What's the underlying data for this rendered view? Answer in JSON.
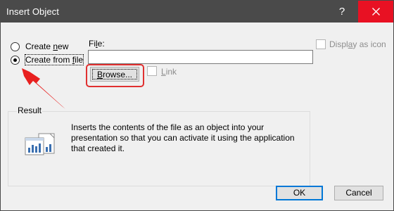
{
  "window": {
    "title": "Insert Object",
    "help_glyph": "?",
    "close_icon": "close-icon"
  },
  "options": {
    "create_new": {
      "prefix": "Create ",
      "accel": "n",
      "suffix": "ew",
      "selected": false
    },
    "create_from_file": {
      "prefix": "Create from ",
      "accel": "f",
      "suffix": "ile",
      "selected": true
    }
  },
  "file": {
    "label_prefix": "Fi",
    "label_accel": "l",
    "label_suffix": "e:",
    "value": ""
  },
  "browse_button": {
    "accel": "B",
    "rest": "rowse..."
  },
  "link_checkbox": {
    "accel": "L",
    "rest": "ink",
    "checked": false,
    "enabled": false
  },
  "display_as_icon_checkbox": {
    "prefix": "Displ",
    "accel": "a",
    "rest": "y as icon",
    "checked": false,
    "enabled": false
  },
  "result": {
    "legend": "Result",
    "lines": [
      "Inserts the contents of the file as an object into your",
      "presentation so that you can activate it using the application",
      "that created it."
    ],
    "icon": "document-chart-icon"
  },
  "buttons": {
    "ok": "OK",
    "cancel": "Cancel"
  },
  "annotation": {
    "highlight_color": "#e03030",
    "arrow_color": "#e8201f",
    "arrow_icon": "red-arrow-annotation"
  },
  "colors": {
    "titlebar": "#4a4a4a",
    "close_hover": "#e81123",
    "dialog_bg": "#f0f0f0",
    "default_button_border": "#0078d7"
  }
}
